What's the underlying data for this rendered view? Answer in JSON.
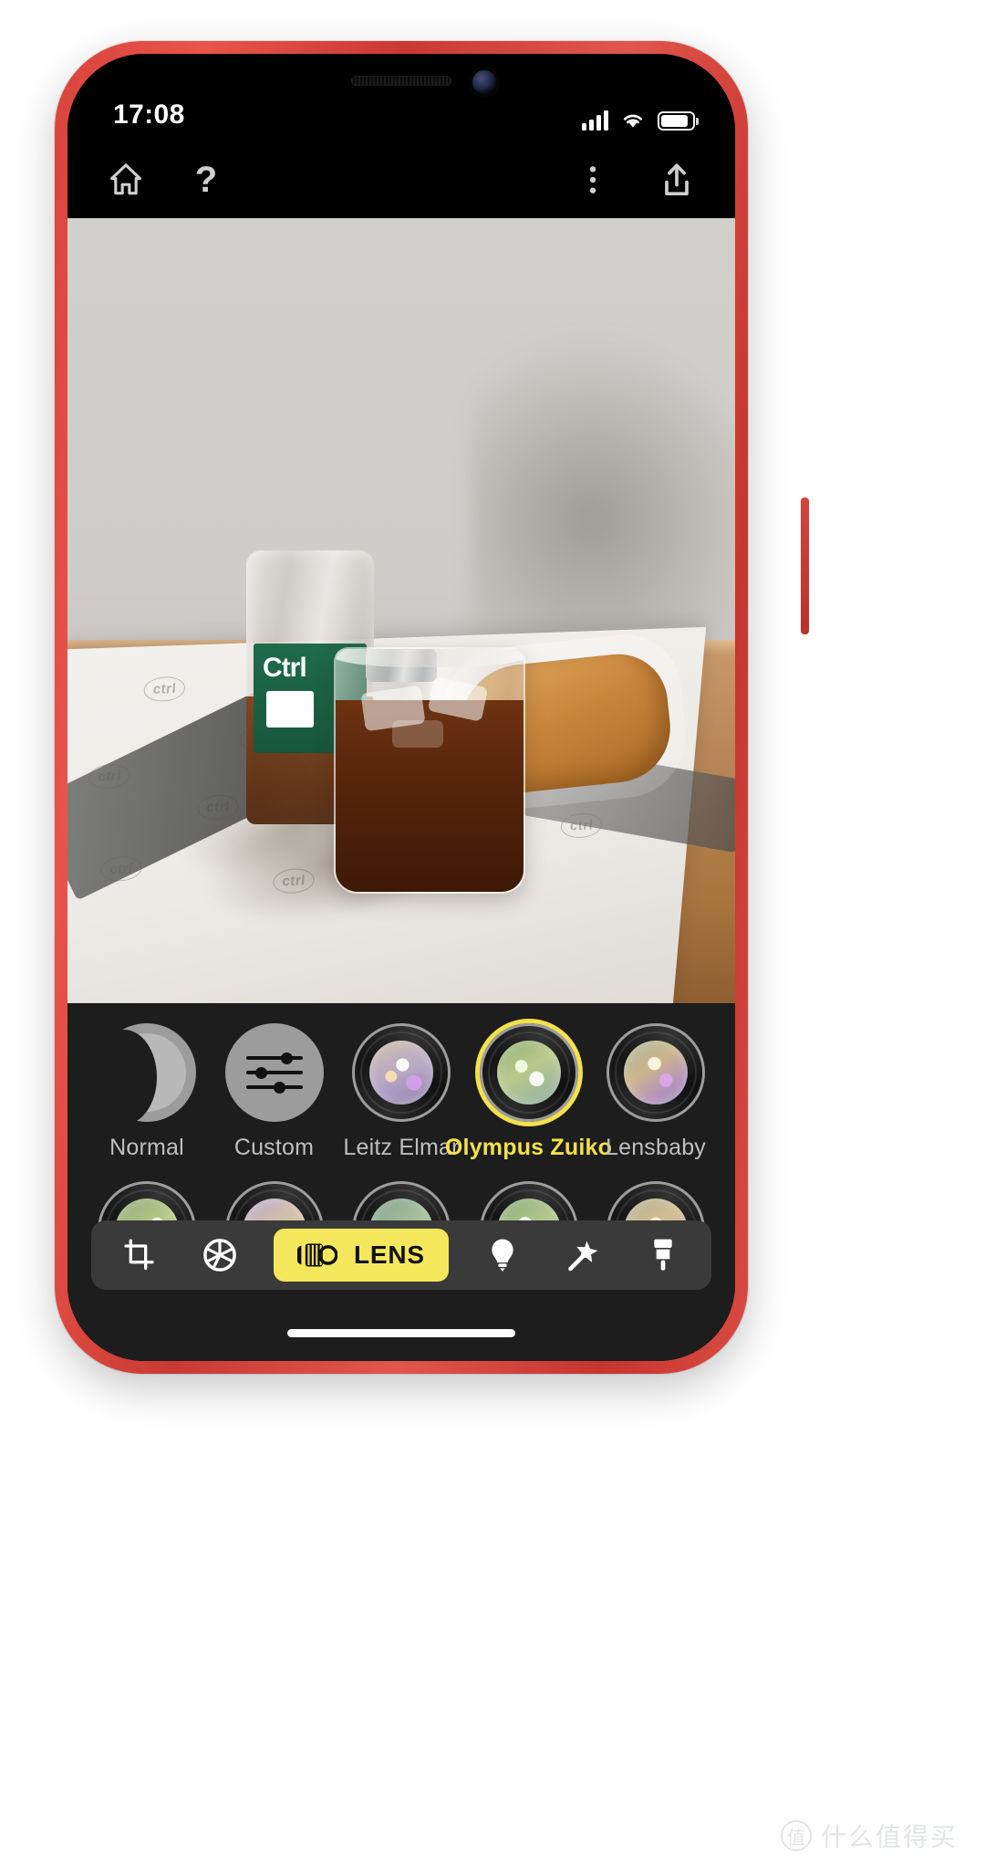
{
  "status_bar": {
    "time": "17:08",
    "signal_icon": "cellular-signal-icon",
    "wifi_icon": "wifi-icon",
    "battery_icon": "battery-icon"
  },
  "app_bar": {
    "home_icon": "home-icon",
    "help_label": "?",
    "more_icon": "more-vertical-icon",
    "share_icon": "share-upload-icon"
  },
  "photo": {
    "description": "Iced coffee in glass, bottle and croissant on wooden table",
    "bottle_label_text": "Ctrl"
  },
  "lens_picker": {
    "row1": [
      {
        "label": "Normal",
        "selected": false,
        "thumb": "moon-thumb"
      },
      {
        "label": "Custom",
        "selected": false,
        "thumb": "sliders-thumb"
      },
      {
        "label": "Leitz Elmar",
        "selected": false,
        "thumb": "lens-thumb"
      },
      {
        "label": "Olympus Zuiko",
        "selected": true,
        "thumb": "lens-thumb"
      },
      {
        "label": "Lensbaby",
        "selected": false,
        "thumb": "lens-thumb"
      }
    ],
    "row2": [
      {
        "label": "",
        "selected": false,
        "thumb": "lens-thumb"
      },
      {
        "label": "",
        "selected": false,
        "thumb": "lens-thumb"
      },
      {
        "label": "",
        "selected": false,
        "thumb": "lens-thumb"
      },
      {
        "label": "",
        "selected": false,
        "thumb": "lens-thumb"
      },
      {
        "label": "",
        "selected": false,
        "thumb": "lens-thumb"
      }
    ],
    "selected_color": "#f2e14a"
  },
  "toolbar": {
    "crop_icon": "crop-icon",
    "aperture_icon": "aperture-icon",
    "lens_label": "LENS",
    "lens_icon": "lens-barrel-icon",
    "light_icon": "lightbulb-icon",
    "magic_icon": "magic-wand-icon",
    "brush_icon": "paintbrush-icon",
    "active_tool": "LENS",
    "active_color": "#f5e75c"
  },
  "watermark": {
    "mark": "值",
    "text": "什么值得买"
  }
}
